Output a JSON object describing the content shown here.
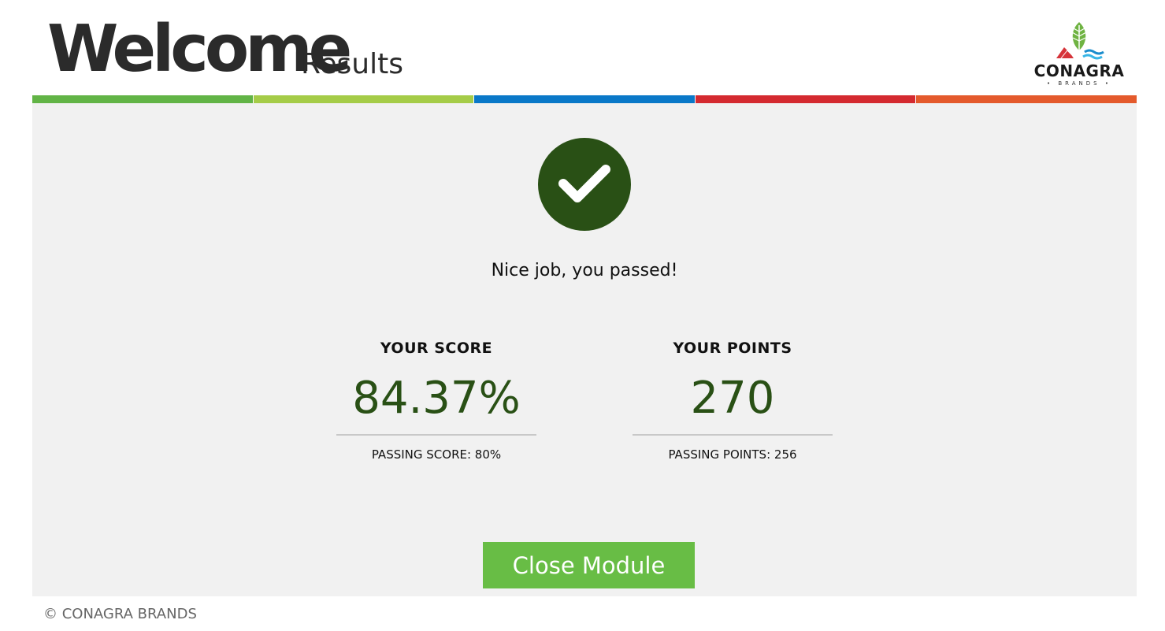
{
  "header": {
    "title": "Welcome",
    "section": "Results"
  },
  "logo": {
    "name": "CONAGRA",
    "sub": "• BRANDS •",
    "icon": "conagra-leaf-logo"
  },
  "color_bar": {
    "colors": [
      "#62b446",
      "#a5cc48",
      "#0a78c8",
      "#d42a30",
      "#e45a2c"
    ]
  },
  "result": {
    "icon": "checkmark-icon",
    "icon_color": "#295015",
    "message": "Nice job, you passed!"
  },
  "score": {
    "label": "YOUR SCORE",
    "value": "84.37%",
    "passing": "PASSING SCORE: 80%"
  },
  "points": {
    "label": "YOUR POINTS",
    "value": "270",
    "passing": "PASSING POINTS: 256"
  },
  "actions": {
    "close_label": "Close Module",
    "close_color": "#68bd45"
  },
  "footer": {
    "copyright": "© CONAGRA BRANDS"
  }
}
